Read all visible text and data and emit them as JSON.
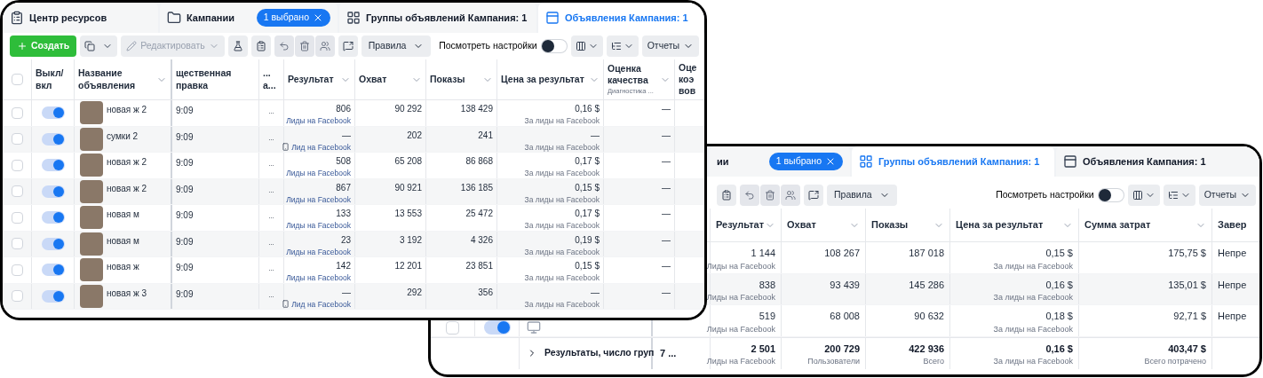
{
  "ads_window": {
    "tabs": [
      {
        "label": "Центр ресурсов",
        "selected": false
      },
      {
        "label": "Кампании",
        "badge": "1 выбрано",
        "selected": false
      },
      {
        "label": "Группы объявлений Кампания: 1",
        "selected": false
      },
      {
        "label": "Объявления Кампания: 1",
        "selected": true
      }
    ],
    "toolbar": {
      "create": "Создать",
      "edit": {
        "label": "Редактировать",
        "disabled": true
      },
      "rules": "Правила",
      "view_settings": {
        "label": "Посмотреть настройки",
        "on": false
      },
      "reports": "Отчеты"
    },
    "select_all": false,
    "columns": [
      {
        "label": "Выкл/ вкл",
        "sortable": false
      },
      {
        "label": "Название объявления",
        "sortable": true
      },
      {
        "label": "щественная правка",
        "sortable": false
      },
      {
        "label": "... а...",
        "sortable": false
      },
      {
        "label": "Результат",
        "sortable": true
      },
      {
        "label": "Охват",
        "sortable": true
      },
      {
        "label": "Показы",
        "sortable": true
      },
      {
        "label": "Цена за результат",
        "sortable": true
      },
      {
        "label": "Оценка качества",
        "sublabel": "Диагностика ...",
        "sortable": true
      },
      {
        "label": "Оце коэ вов",
        "sortable": false
      }
    ],
    "rows": [
      {
        "kind": "plain",
        "checked": false,
        "on": true,
        "name": "новая ж 2",
        "time": "9:09",
        "column_4": "...",
        "result": "806",
        "result_note": "Лиды на Facebook",
        "reach": "90 292",
        "impressions": "138 429",
        "cost": "0,16 $",
        "cost_note": "За лиды на Facebook",
        "quality": "—"
      },
      {
        "kind": "phone",
        "checked": false,
        "on": true,
        "name": "сумки 2",
        "time": "9:09",
        "column_4": "...",
        "result": "—",
        "result_note": "Лид на Facebook",
        "reach": "202",
        "impressions": "241",
        "cost": "—",
        "cost_note": "За лиды на Facebook",
        "quality": "—"
      },
      {
        "kind": "plain",
        "checked": false,
        "on": true,
        "name": "новая ж 2",
        "time": "9:09",
        "column_4": "...",
        "result": "508",
        "result_note": "Лиды на Facebook",
        "reach": "65 208",
        "impressions": "86 868",
        "cost": "0,17 $",
        "cost_note": "За лиды на Facebook",
        "quality": "—"
      },
      {
        "kind": "plain",
        "checked": false,
        "on": true,
        "name": "новая ж 2",
        "time": "9:09",
        "column_4": "...",
        "result": "867",
        "result_note": "Лиды на Facebook",
        "reach": "90 921",
        "impressions": "136 185",
        "cost": "0,15 $",
        "cost_note": "За лиды на Facebook",
        "quality": "—"
      },
      {
        "kind": "plain",
        "checked": false,
        "on": true,
        "name": "новая м",
        "time": "9:09",
        "column_4": "...",
        "result": "133",
        "result_note": "Лиды на Facebook",
        "reach": "13 553",
        "impressions": "25 472",
        "cost": "0,17 $",
        "cost_note": "За лиды на Facebook",
        "quality": "—"
      },
      {
        "kind": "plain",
        "checked": false,
        "on": true,
        "name": "новая м",
        "time": "9:09",
        "column_4": "...",
        "result": "23",
        "result_note": "Лиды на Facebook",
        "reach": "3 192",
        "impressions": "4 326",
        "cost": "0,19 $",
        "cost_note": "За лиды на Facebook",
        "quality": "—"
      },
      {
        "kind": "plain",
        "checked": false,
        "on": true,
        "name": "новая ж",
        "time": "9:09",
        "column_4": "...",
        "result": "142",
        "result_note": "Лиды на Facebook",
        "reach": "12 201",
        "impressions": "23 851",
        "cost": "0,15 $",
        "cost_note": "За лиды на Facebook",
        "quality": "—"
      },
      {
        "kind": "phone",
        "checked": false,
        "on": true,
        "name": "новая ж 3",
        "time": "9:09",
        "column_4": "...",
        "result": "—",
        "result_note": "Лид на Facebook",
        "reach": "292",
        "impressions": "356",
        "cost": "—",
        "cost_note": "За лиды на Facebook",
        "quality": "—"
      }
    ]
  },
  "ad_sets_window": {
    "tabs": [
      {
        "label": "ии",
        "badge": "1 выбрано",
        "selected": false
      },
      {
        "label": "Группы объявлений Кампания: 1",
        "selected": true
      },
      {
        "label": "Объявления Кампания: 1",
        "selected": false
      }
    ],
    "toolbar": {
      "rules": "Правила",
      "view_settings": {
        "label": "Посмотреть настройки",
        "on": false
      },
      "reports": "Отчеты"
    },
    "columns": [
      {
        "label": "Результат"
      },
      {
        "label": "Охват"
      },
      {
        "label": "Показы"
      },
      {
        "label": "Цена за результат"
      },
      {
        "label": "Сумма затрат"
      },
      {
        "label": "Завер"
      }
    ],
    "rows": [
      {
        "result": "1 144",
        "result_note": "Лиды на Facebook",
        "reach": "108 267",
        "impressions": "187 018",
        "cost": "0,15 $",
        "cost_note": "За лиды на Facebook",
        "spend": "175,75 $",
        "status": "Непре"
      },
      {
        "result": "838",
        "result_note": "Лиды на Facebook",
        "reach": "93 439",
        "impressions": "145 286",
        "cost": "0,16 $",
        "cost_note": "За лиды на Facebook",
        "spend": "135,01 $",
        "status": "Непре"
      },
      {
        "checked": false,
        "on": true,
        "result": "519",
        "result_note": "Лиды на Facebook",
        "reach": "68 008",
        "impressions": "90 632",
        "cost": "0,18 $",
        "cost_note": "За лиды на Facebook",
        "spend": "92,71 $",
        "status": "Непре"
      }
    ],
    "totals": {
      "label": "Результаты, число груп",
      "column_4": "7 ...",
      "result": "2 501",
      "result_note": "Лиды на Facebook",
      "reach": "200 729",
      "reach_note": "Пользователи",
      "impressions": "422 936",
      "impressions_note": "Всего",
      "cost": "0,16 $",
      "cost_note": "За лиды на Facebook",
      "spend": "403,47 $",
      "spend_note": "Всего потрачено"
    }
  }
}
